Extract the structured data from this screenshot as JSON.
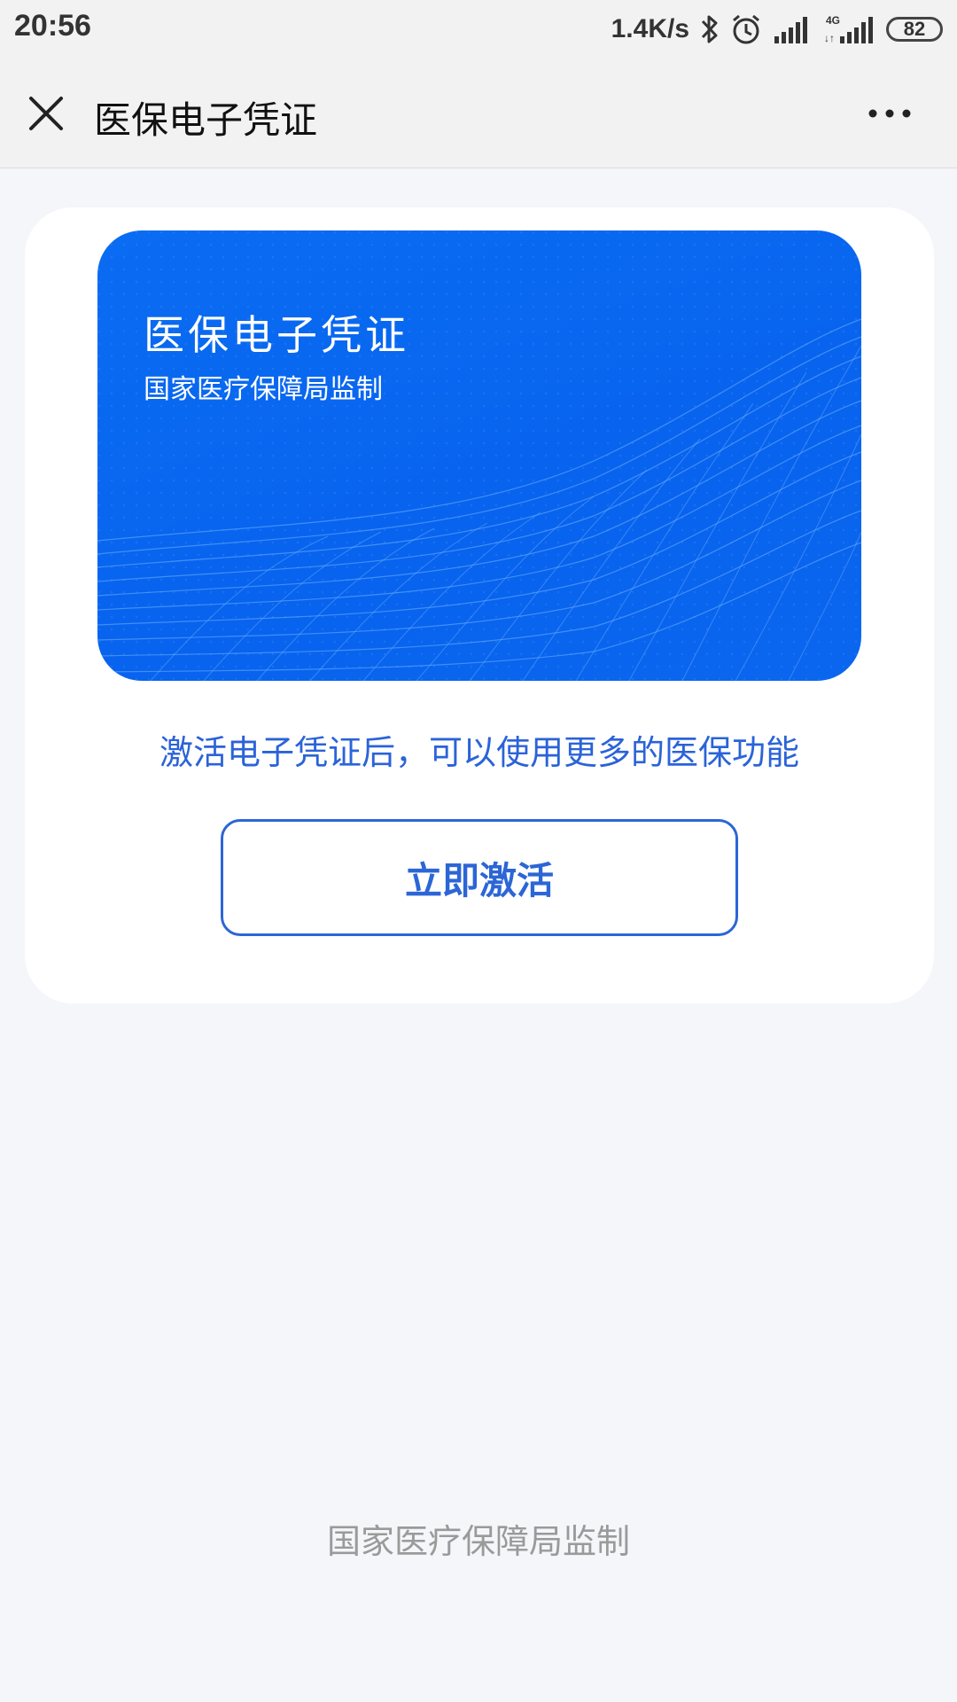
{
  "status_bar": {
    "time": "20:56",
    "net_speed": "1.4K/s",
    "network_type": "4G",
    "battery": "82",
    "icons": [
      "bluetooth-icon",
      "alarm-icon",
      "signal-icon",
      "signal-4g-icon"
    ]
  },
  "title_bar": {
    "title": "医保电子凭证",
    "close_icon": "close-icon",
    "more_icon": "more-icon"
  },
  "card": {
    "title": "医保电子凭证",
    "subtitle": "国家医疗保障局监制",
    "color": "#0a6cf2"
  },
  "hint": "激活电子凭证后，可以使用更多的医保功能",
  "activate_button": {
    "label": "立即激活",
    "color": "#2c66d6"
  },
  "footer": "国家医疗保障局监制"
}
